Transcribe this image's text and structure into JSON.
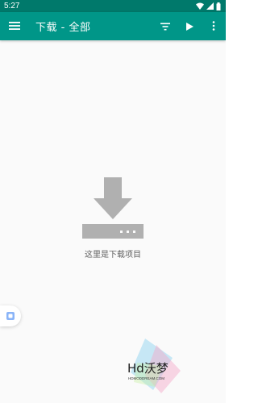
{
  "status_bar": {
    "time": "5:27"
  },
  "app_bar": {
    "title": "下载 - 全部",
    "menu_icon": "menu-icon",
    "actions": [
      "filter-icon",
      "play-icon",
      "more-vert-icon"
    ]
  },
  "empty_state": {
    "icon": "download-icon",
    "message": "这里是下载项目"
  },
  "watermark": {
    "brand": "Hd沃梦",
    "site": "HDMODDREAM.COM"
  },
  "colors": {
    "app_bar": "#009688",
    "status_bar": "#00796b",
    "background": "#fafafa",
    "empty_icon": "#b0b0b0",
    "text_secondary": "#616161"
  }
}
